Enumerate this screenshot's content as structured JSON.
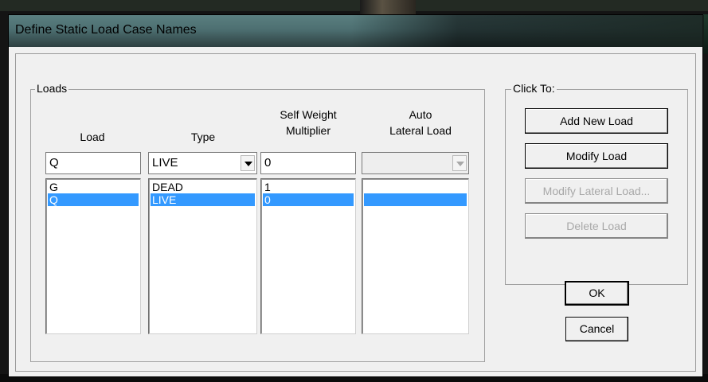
{
  "dialog": {
    "title": "Define Static Load Case Names"
  },
  "loads_group": {
    "label": "Loads",
    "headers": {
      "load": "Load",
      "type": "Type",
      "self_weight_line1": "Self Weight",
      "self_weight_line2": "Multiplier",
      "auto_line1": "Auto",
      "auto_line2": "Lateral Load"
    },
    "edit_row": {
      "load": "Q",
      "type": "LIVE",
      "self_weight": "0",
      "auto_lateral": ""
    },
    "rows": [
      {
        "load": "G",
        "type": "DEAD",
        "self_weight": "1",
        "auto_lateral": "",
        "selected": false
      },
      {
        "load": "Q",
        "type": "LIVE",
        "self_weight": "0",
        "auto_lateral": "",
        "selected": true
      }
    ]
  },
  "click_to_group": {
    "label": "Click To:",
    "add_new_load": "Add New Load",
    "modify_load": "Modify Load",
    "modify_lateral_load": "Modify Lateral Load...",
    "delete_load": "Delete Load"
  },
  "buttons": {
    "ok": "OK",
    "cancel": "Cancel"
  },
  "colors": {
    "selection": "#3399ff",
    "disabled_text": "#a8a8a8",
    "titlebar": "#4d6f71"
  },
  "icons": {
    "dropdown": "chevron-down-icon"
  }
}
